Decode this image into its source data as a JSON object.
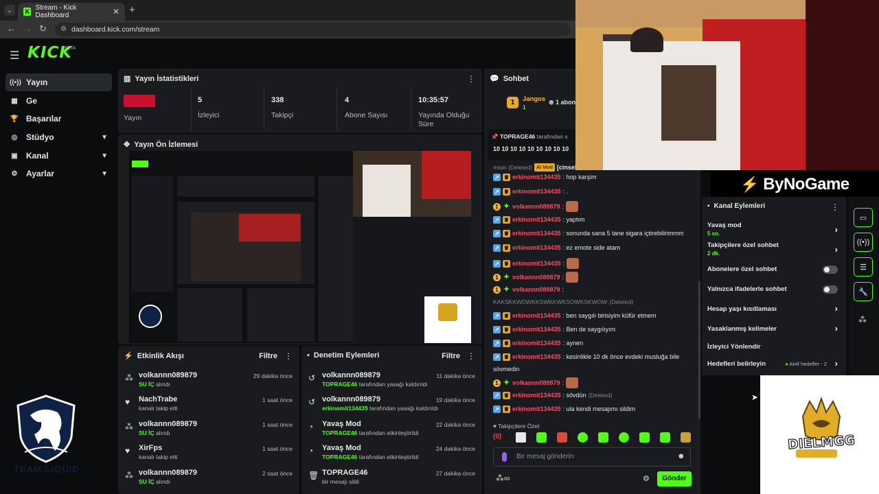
{
  "browser": {
    "tab_title": "Stream - Kick Dashboard",
    "url": "dashboard.kick.com/stream",
    "new_tab": "+",
    "close": "✕"
  },
  "brand": {
    "logo": "KICK",
    "beta": "BETA",
    "accent": "#53fc18"
  },
  "sidebar": {
    "items": [
      {
        "label": "Yayın",
        "icon": "broadcast-icon"
      },
      {
        "label": "Ge",
        "icon": "chart-icon"
      },
      {
        "label": "Başarılar",
        "icon": "trophy-icon"
      },
      {
        "label": "Stüdyo",
        "icon": "studio-icon"
      },
      {
        "label": "Kanal",
        "icon": "channel-icon"
      },
      {
        "label": "Ayarlar",
        "icon": "gear-icon"
      }
    ]
  },
  "stats": {
    "title": "Yayın İstatistikleri",
    "items": [
      {
        "value": "",
        "label": "Yayın"
      },
      {
        "value": "5",
        "label": "İzleyici"
      },
      {
        "value": "338",
        "label": "Takipçi"
      },
      {
        "value": "4",
        "label": "Abone Sayısı"
      },
      {
        "value": "10:35:57",
        "label": "Yayında Olduğu Süre"
      }
    ]
  },
  "preview": {
    "title": "Yayın Ön İzlemesi"
  },
  "activity": {
    "title": "Etkinlik Akışı",
    "filter": "Filtre",
    "rows": [
      {
        "icon": "gift-icon",
        "name": "volkannn089879",
        "sub_hl": "SU İÇ",
        "sub": " alındı",
        "time": "29 dakika önce"
      },
      {
        "icon": "heart-icon",
        "name": "NachTrabe",
        "sub_hl": "",
        "sub": "kanalı takip etti",
        "time": "1 saat önce"
      },
      {
        "icon": "gift-icon",
        "name": "volkannn089879",
        "sub_hl": "SU İÇ",
        "sub": " alındı",
        "time": "1 saat önce"
      },
      {
        "icon": "heart-icon",
        "name": "XirFps",
        "sub_hl": "",
        "sub": "kanalı takip etti",
        "time": "1 saat önce"
      },
      {
        "icon": "gift-icon",
        "name": "volkannn089879",
        "sub_hl": "SU İÇ",
        "sub": " alındı",
        "time": "2 saat önce"
      }
    ]
  },
  "moderation": {
    "title": "Denetim Eylemleri",
    "filter": "Filtre",
    "rows": [
      {
        "icon": "undo-icon",
        "name": "volkannn089879",
        "sub_hl": "TOPRAGE46",
        "sub": " tarafından yasağı kaldırıldı",
        "time": "11 dakika önce"
      },
      {
        "icon": "undo-icon",
        "name": "volkannn089879",
        "sub_hl": "erkinomit134435",
        "sub": " tarafından yasağı kaldırıldı",
        "time": "19 dakika önce"
      },
      {
        "icon": "slow-icon",
        "name": "Yavaş Mod",
        "sub_hl": "TOPRAGE46",
        "sub": " tarafından etkinleştirildi",
        "time": "22 dakika önce"
      },
      {
        "icon": "slow-icon",
        "name": "Yavaş Mod",
        "sub_hl": "TOPRAGE46",
        "sub": " tarafından etkinleştirildi",
        "time": "24 dakika önce"
      },
      {
        "icon": "trash-icon",
        "name": "TOPRAGE46",
        "sub_hl": "",
        "sub": "bir mesajı sildi",
        "time": "27 dakika önce"
      }
    ]
  },
  "chat": {
    "title": "Sohbet",
    "top_user": "Jangos",
    "top_count": "1",
    "top_rank": "1",
    "sub_label": "1 abon",
    "pinned_by": "TOPRAGE46",
    "pinned_suffix": " tarafından s",
    "pinned_text": "10 10 10 10 10 10 10 10 10",
    "ai_line_pre": "misin (Deleted)",
    "ai_badge": "AI Mod",
    "ai_line_post": "[cinselli",
    "messages": [
      {
        "type": "mod",
        "user": "erkinomit134435",
        "text": ": hop karşim"
      },
      {
        "type": "mod",
        "user": "erkinomit134435",
        "text": ": ."
      },
      {
        "type": "sub",
        "user": "volkannn089879",
        "text": ":",
        "emote": true
      },
      {
        "type": "mod",
        "user": "erkinomit134435",
        "text": ": yaptım"
      },
      {
        "type": "mod",
        "user": "erkinomit134435",
        "text": ": sonunda sana 5 tane sigara içtirebilirimmm"
      },
      {
        "type": "mod",
        "user": "erkinomit134435",
        "text": ": ez emote side atam"
      },
      {
        "type": "mod",
        "user": "erkinomit134435",
        "text": ":",
        "emote": true
      },
      {
        "type": "sub",
        "user": "volkannn089879",
        "text": ":",
        "emote": true
      },
      {
        "type": "sub",
        "user": "volkannn089879",
        "text": ":"
      },
      {
        "type": "deleted",
        "text": "KAKSKKWDWKKSWKKWKSOWKSKWOW",
        "tag": "(Deleted)"
      },
      {
        "type": "mod",
        "user": "erkinomit134435",
        "text": ": ben saygılı birisiyim küfür etmem"
      },
      {
        "type": "mod",
        "user": "erkinomit134435",
        "text": ": Ben de saygılıyım"
      },
      {
        "type": "mod",
        "user": "erkinomit134435",
        "text": ": aynen"
      },
      {
        "type": "mod",
        "user": "erkinomit134435",
        "text": ": kesinlikle 10 dk önce evdeki musluğa bile"
      },
      {
        "type": "cont",
        "text": "sövmedin"
      },
      {
        "type": "sub",
        "user": "volkannn089879",
        "text": ":",
        "emote": true
      },
      {
        "type": "mod",
        "user": "erkinomit134435",
        "text": ": sövdün",
        "tag": "(Deleted)"
      },
      {
        "type": "mod",
        "user": "erkinomit134435",
        "text": ": ula kendi mesajımı sildim"
      }
    ],
    "followers_only": "Takipçilere Özel",
    "placeholder": "Bir mesaj gönderin",
    "send": "Gönder"
  },
  "channel_actions": {
    "title": "Kanal Eylemleri",
    "slow_mode": "Yavaş mod",
    "slow_mode_value": "5 sn.",
    "followers_chat": "Takipçilere özel sohbet",
    "followers_value": "2 dk.",
    "subscribers_chat": "Abonelere özel sohbet",
    "emotes_chat": "Yalnızca ifadelerle sohbet",
    "age_restrict": "Hesap yaşı kısıtlaması",
    "banned_words": "Yasaklanmış kelimeler",
    "redirect": "İzleyici Yönlendir",
    "goals": "Hedefleri belirleyin",
    "goals_status": "Aktif hedefler - 2"
  },
  "overlays": {
    "sponsor": "ByNoGame",
    "diel": "DIELMGG",
    "team_text": "TEAM LIQUID"
  }
}
